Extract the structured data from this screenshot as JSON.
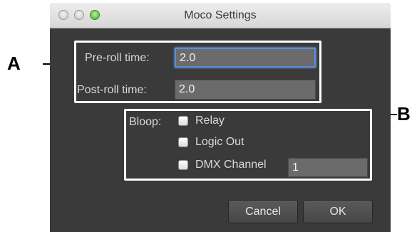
{
  "window": {
    "title": "Moco Settings"
  },
  "fields": {
    "preroll_label": "Pre-roll time:",
    "preroll_value": "2.0",
    "postroll_label": "Post-roll time:",
    "postroll_value": "2.0"
  },
  "bloop": {
    "label": "Bloop:",
    "options": [
      {
        "label": "Relay",
        "checked": false
      },
      {
        "label": "Logic Out",
        "checked": false
      },
      {
        "label": "DMX Channel",
        "checked": false
      }
    ],
    "dmx_channel_value": "1"
  },
  "buttons": {
    "cancel": "Cancel",
    "ok": "OK"
  },
  "callouts": {
    "a": "A",
    "b": "B"
  },
  "colors": {
    "dialog_bg": "#3a3a3a",
    "field_bg": "#6b6b6b",
    "focus_ring": "#5a8fd6",
    "zoom_button": "#47a827"
  }
}
